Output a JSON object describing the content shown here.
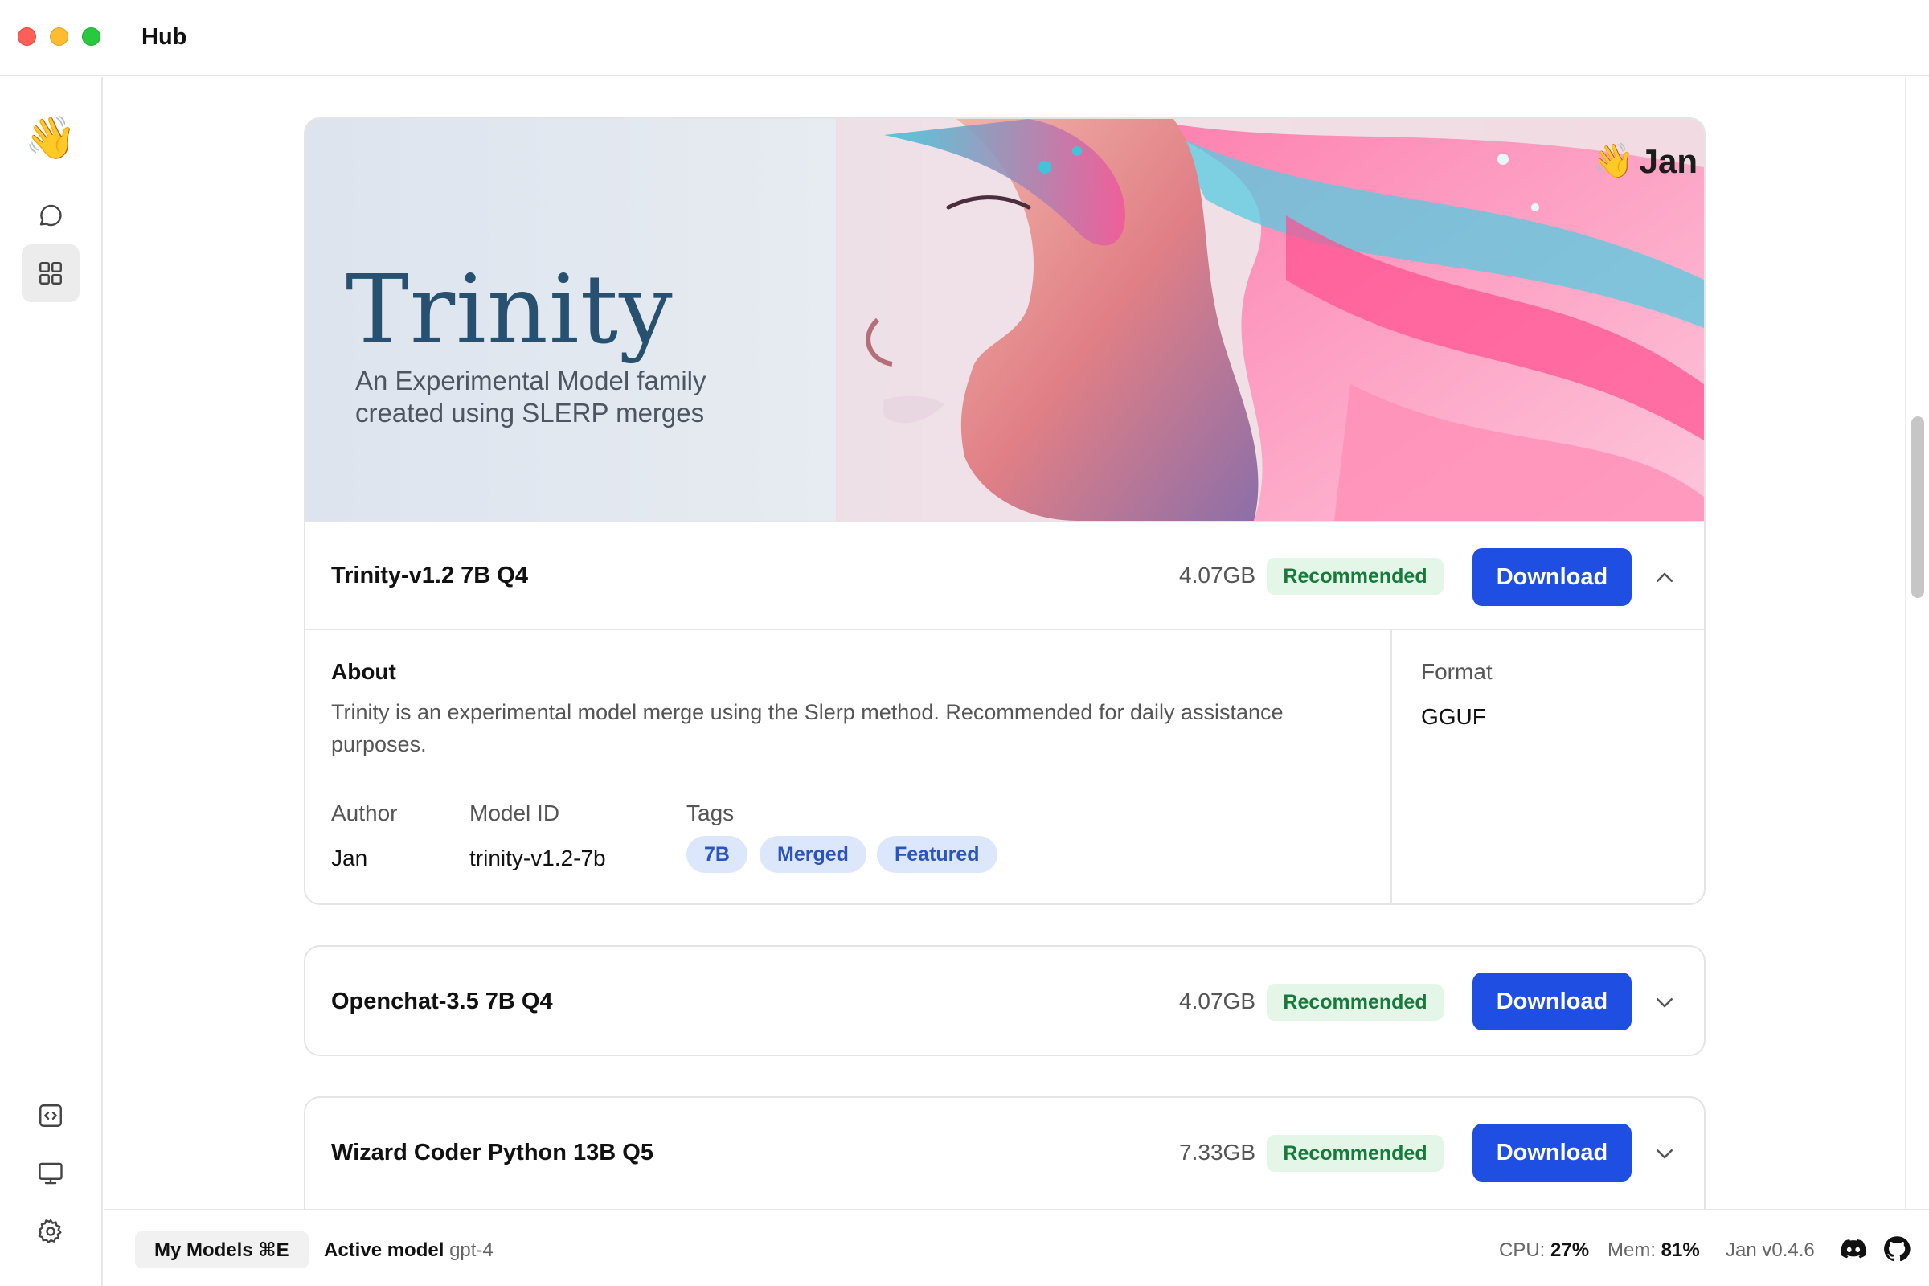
{
  "window": {
    "title": "Hub"
  },
  "sidebar": {
    "top_items": [
      {
        "name": "app-logo",
        "icon": "waving-hand-icon"
      },
      {
        "name": "chat",
        "icon": "chat-bubble-icon"
      },
      {
        "name": "hub",
        "icon": "grid-icon",
        "active": true
      }
    ],
    "bottom_items": [
      {
        "name": "local-api-server",
        "icon": "code-window-icon"
      },
      {
        "name": "system-monitor",
        "icon": "monitor-icon"
      },
      {
        "name": "settings",
        "icon": "gear-icon"
      }
    ]
  },
  "banner": {
    "title": "Trinity",
    "subtitle_line1": "An Experimental Model family",
    "subtitle_line2": "created using SLERP merges",
    "brand": "Jan"
  },
  "models": [
    {
      "name": "Trinity-v1.2 7B Q4",
      "size": "4.07GB",
      "badge": "Recommended",
      "action": "Download",
      "expanded": true,
      "about_label": "About",
      "about_text": "Trinity is an experimental model merge using the Slerp method. Recommended for daily assistance purposes.",
      "author_label": "Author",
      "author": "Jan",
      "model_id_label": "Model ID",
      "model_id": "trinity-v1.2-7b",
      "tags_label": "Tags",
      "tags": [
        "7B",
        "Merged",
        "Featured"
      ],
      "format_label": "Format",
      "format": "GGUF"
    },
    {
      "name": "Openchat-3.5 7B Q4",
      "size": "4.07GB",
      "badge": "Recommended",
      "action": "Download",
      "expanded": false
    },
    {
      "name": "Wizard Coder Python 13B Q5",
      "size": "7.33GB",
      "badge": "Recommended",
      "action": "Download",
      "expanded": false
    }
  ],
  "statusbar": {
    "my_models": "My Models ⌘E",
    "active_model_label": "Active model",
    "active_model_value": "gpt-4",
    "cpu_label": "CPU:",
    "cpu_value": "27%",
    "mem_label": "Mem:",
    "mem_value": "81%",
    "version": "Jan v0.4.6",
    "icons": [
      "discord-icon",
      "github-icon"
    ]
  },
  "colors": {
    "primary": "#1f4ee3",
    "recommended_bg": "#e3f6e8",
    "recommended_text": "#177a3b",
    "tag_bg": "#dde7fb",
    "tag_text": "#2a55bf"
  }
}
